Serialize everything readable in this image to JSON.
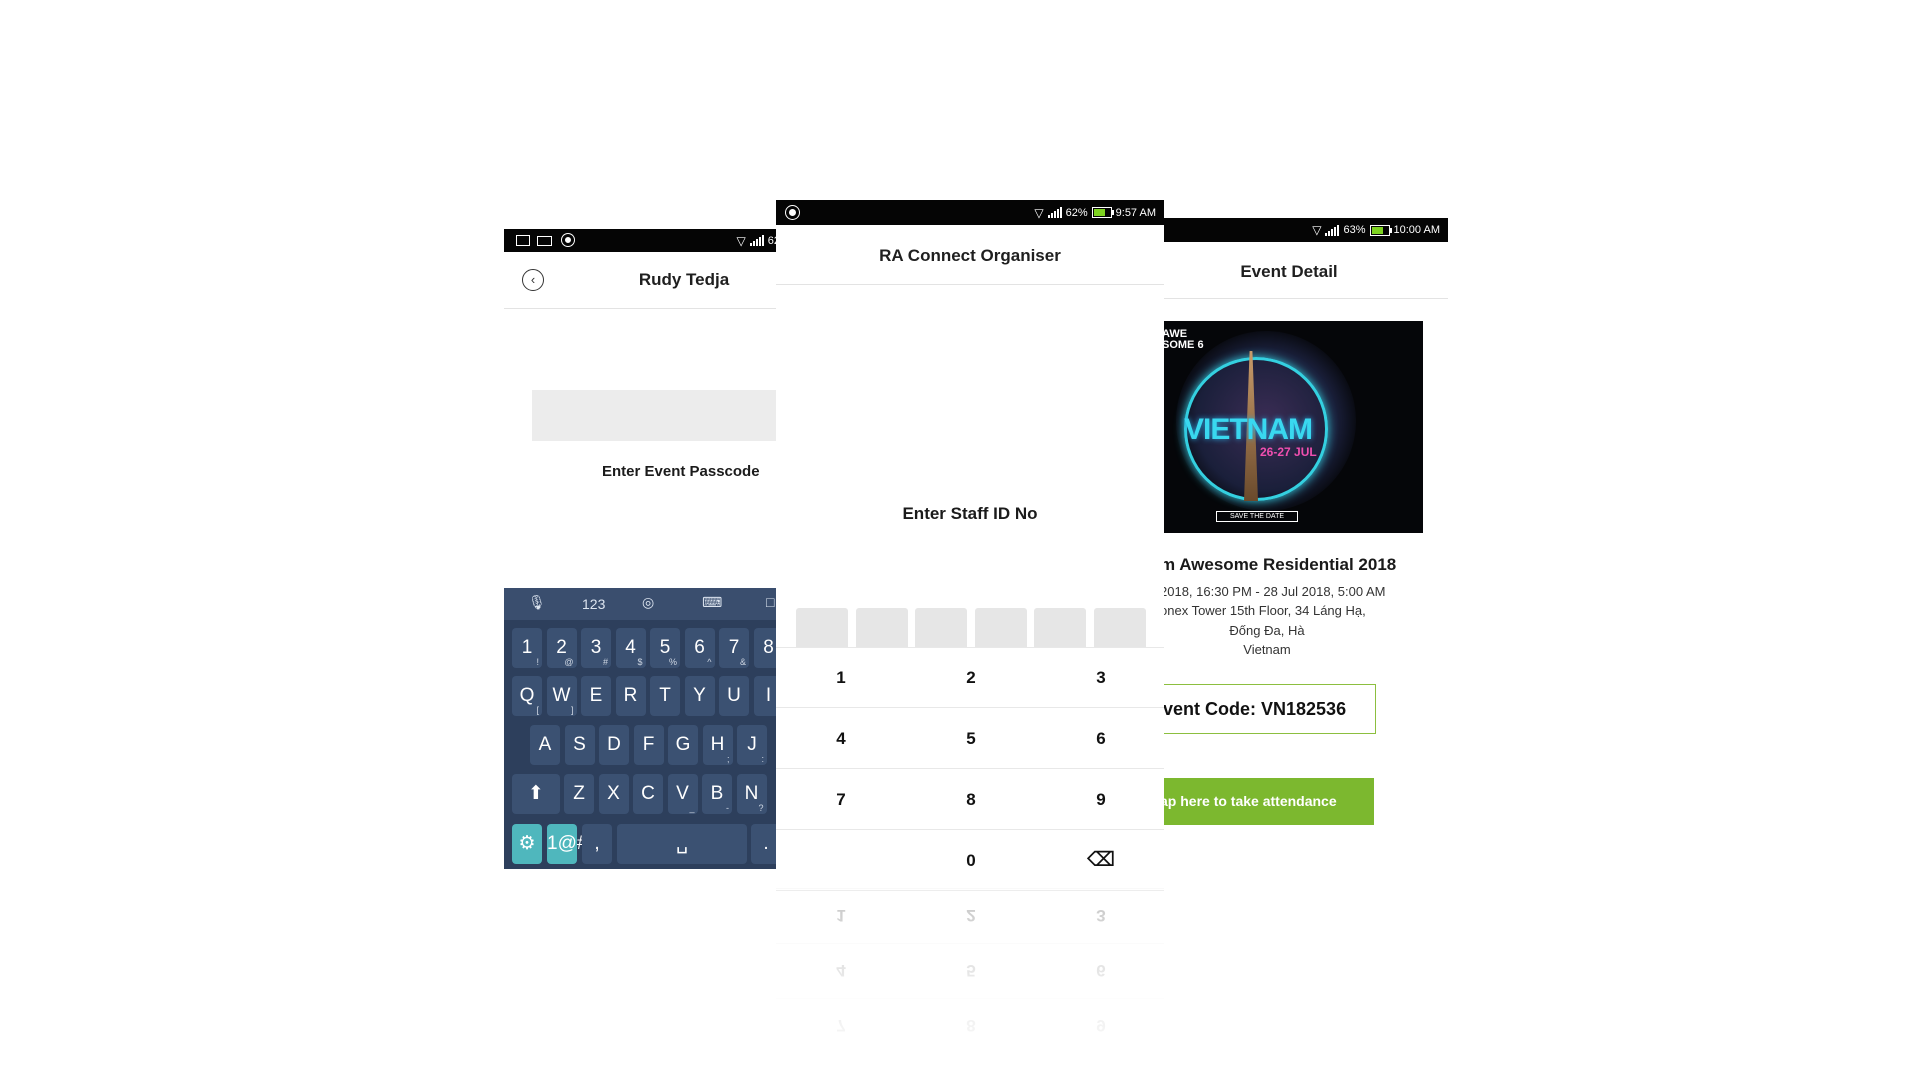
{
  "screen1": {
    "status_right": "62",
    "title": "Rudy Tedja",
    "prompt": "Enter Event Passcode",
    "keyboard": {
      "toolbar": [
        "123"
      ],
      "row_numbers": [
        {
          "k": "1",
          "s": "!"
        },
        {
          "k": "2",
          "s": "@"
        },
        {
          "k": "3",
          "s": "#"
        },
        {
          "k": "4",
          "s": "$"
        },
        {
          "k": "5",
          "s": "%"
        },
        {
          "k": "6",
          "s": "^"
        },
        {
          "k": "7",
          "s": "&"
        },
        {
          "k": "8",
          "s": ""
        }
      ],
      "row_q": [
        {
          "k": "Q",
          "s": "["
        },
        {
          "k": "W",
          "s": "]"
        },
        {
          "k": "E",
          "s": ""
        },
        {
          "k": "R",
          "s": ""
        },
        {
          "k": "T",
          "s": ""
        },
        {
          "k": "Y",
          "s": ""
        },
        {
          "k": "U",
          "s": ""
        },
        {
          "k": "I",
          "s": ""
        }
      ],
      "row_a": [
        {
          "k": "A",
          "s": ""
        },
        {
          "k": "S",
          "s": ""
        },
        {
          "k": "D",
          "s": ""
        },
        {
          "k": "F",
          "s": ""
        },
        {
          "k": "G",
          "s": ""
        },
        {
          "k": "H",
          "s": ";"
        },
        {
          "k": "J",
          "s": ":"
        }
      ],
      "row_z": [
        {
          "k": "Z",
          "s": ""
        },
        {
          "k": "X",
          "s": ""
        },
        {
          "k": "C",
          "s": ""
        },
        {
          "k": "V",
          "s": "_"
        },
        {
          "k": "B",
          "s": "-"
        },
        {
          "k": "N",
          "s": "?"
        }
      ],
      "symbols_key": "1@#",
      "comma_key": ","
    }
  },
  "screen2": {
    "battery": "62%",
    "time": "9:57 AM",
    "title": "RA Connect Organiser",
    "prompt": "Enter Staff ID No",
    "numpad": [
      "1",
      "2",
      "3",
      "4",
      "5",
      "6",
      "7",
      "8",
      "9",
      "",
      "0",
      "⌫"
    ]
  },
  "screen3": {
    "battery": "63%",
    "time": "10:00 AM",
    "title": "Event Detail",
    "poster": {
      "brand": "AWE SOME 6",
      "country": "VIETNAM",
      "dates": "26-27 JUL",
      "tag": "SAVE THE DATE"
    },
    "event_name": "m Awesome Residential 2018",
    "event_dates": "2018, 16:30 PM - 28 Jul 2018, 5:00 AM",
    "address_1": "onex Tower 15th Floor, 34 Láng Hạ,",
    "address_2": "Đống Đa, Hà",
    "address_3": "Vietnam",
    "event_code": "vent Code: VN182536",
    "attendance_button": "ap here to take attendance",
    "accent": "#7cb82f"
  }
}
